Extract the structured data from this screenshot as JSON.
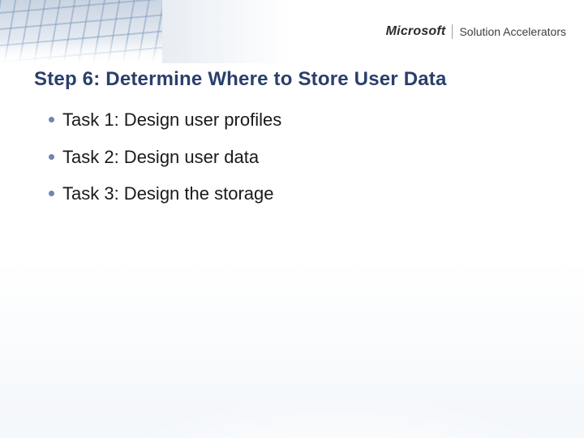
{
  "brand": {
    "company": "Microsoft",
    "product": "Solution Accelerators"
  },
  "title": "Step 6: Determine Where to Store User Data",
  "bullets": [
    "Task 1: Design user profiles",
    "Task 2: Design user data",
    "Task 3: Design the storage"
  ]
}
